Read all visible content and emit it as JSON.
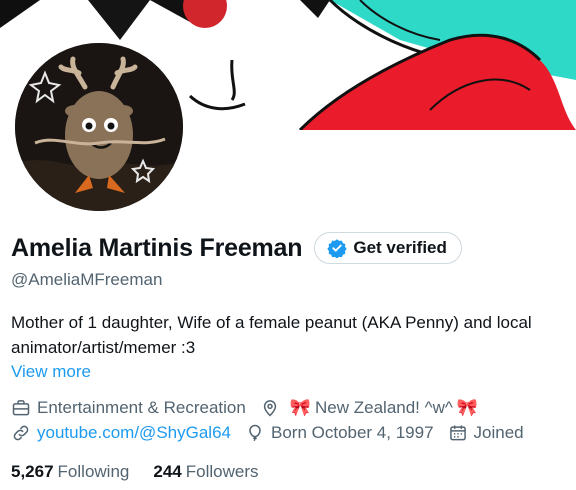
{
  "profile": {
    "display_name": "Amelia Martinis Freeman",
    "handle": "@AmeliaMFreeman",
    "verify_label": "Get verified",
    "bio_line1": "Mother of 1 daughter, Wife of a female peanut (AKA Penny) and local",
    "bio_line2": "animator/artist/memer :3",
    "view_more": "View more"
  },
  "meta": {
    "category": "Entertainment & Recreation",
    "location_bow_left": "🎀",
    "location": "New Zealand! ^w^",
    "location_bow_right": "🎀",
    "website": "youtube.com/@ShyGal64",
    "born": "Born October 4, 1997",
    "joined": "Joined"
  },
  "stats": {
    "following_count": "5,267",
    "following_label": "Following",
    "followers_count": "244",
    "followers_label": "Followers"
  },
  "icons": {
    "category": "briefcase-icon",
    "location": "map-pin-icon",
    "website": "link-icon",
    "born": "balloon-icon",
    "joined": "calendar-icon",
    "verified": "verified-badge-icon"
  },
  "colors": {
    "accent": "#1d9bf0",
    "secondary_text": "#536471",
    "banner_teal": "#2fd9c8",
    "banner_red": "#ea1b2a"
  }
}
